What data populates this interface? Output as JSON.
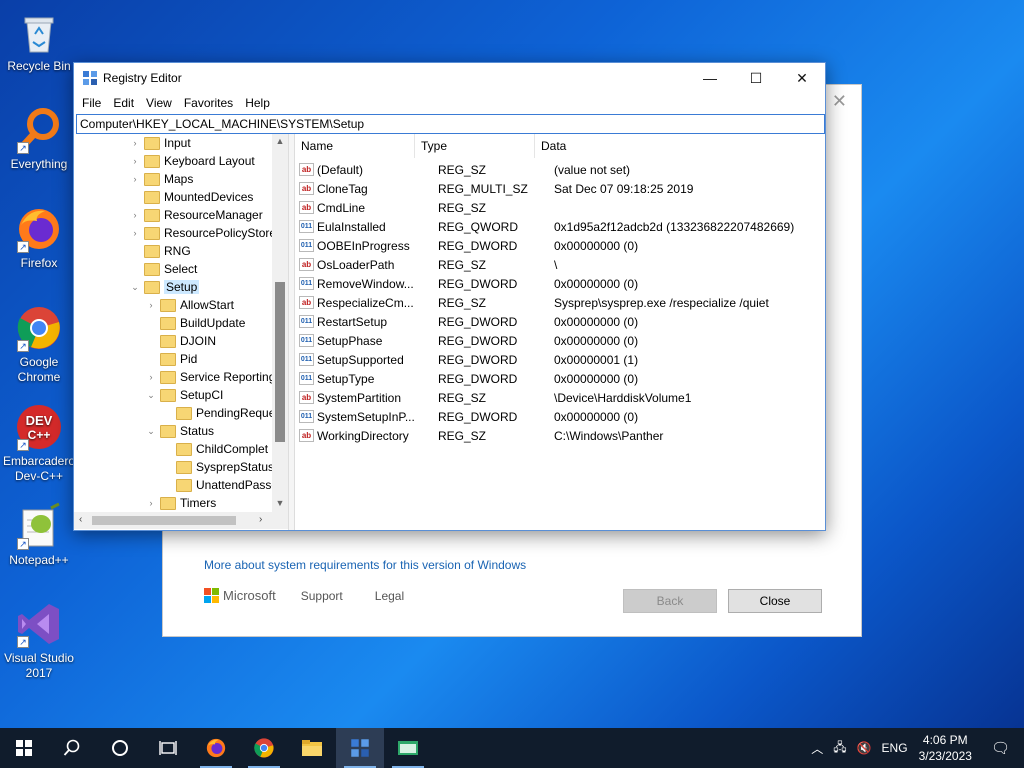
{
  "desktop": {
    "icons": [
      {
        "label": "Recycle Bin"
      },
      {
        "label": "Everything"
      },
      {
        "label": "Firefox"
      },
      {
        "label_line1": "Google",
        "label_line2": "Chrome"
      },
      {
        "label_line1": "Embarcadero",
        "label_line2": "Dev-C++"
      },
      {
        "label": "Notepad++"
      },
      {
        "label_line1": "Visual Studio",
        "label_line2": "2017"
      }
    ]
  },
  "setup_dialog": {
    "close_glyph": "✕",
    "requirements_link": "More about system requirements for this version of Windows",
    "brand": "Microsoft",
    "support_link": "Support",
    "legal_link": "Legal",
    "back_button": "Back",
    "close_button": "Close",
    "colors": {
      "link": "#1a64b3"
    }
  },
  "regedit": {
    "title": "Registry Editor",
    "controls": {
      "minimize": "—",
      "maximize": "☐",
      "close": "✕"
    },
    "menu": [
      "File",
      "Edit",
      "View",
      "Favorites",
      "Help"
    ],
    "address": "Computer\\HKEY_LOCAL_MACHINE\\SYSTEM\\Setup",
    "tree": [
      {
        "label": "Input",
        "expander": "›"
      },
      {
        "label": "Keyboard Layout",
        "expander": "›"
      },
      {
        "label": "Maps",
        "expander": "›"
      },
      {
        "label": "MountedDevices",
        "expander": ""
      },
      {
        "label": "ResourceManager",
        "expander": "›"
      },
      {
        "label": "ResourcePolicyStore",
        "expander": "›"
      },
      {
        "label": "RNG",
        "expander": ""
      },
      {
        "label": "Select",
        "expander": ""
      },
      {
        "label": "Setup",
        "expander": "⌄",
        "selected": true
      },
      {
        "label": "AllowStart",
        "expander": "›"
      },
      {
        "label": "BuildUpdate",
        "expander": ""
      },
      {
        "label": "DJOIN",
        "expander": ""
      },
      {
        "label": "Pid",
        "expander": ""
      },
      {
        "label": "Service Reporting",
        "expander": "›"
      },
      {
        "label": "SetupCI",
        "expander": "⌄"
      },
      {
        "label": "PendingReque",
        "expander": ""
      },
      {
        "label": "Status",
        "expander": "⌄"
      },
      {
        "label": "ChildComplet",
        "expander": ""
      },
      {
        "label": "SysprepStatus",
        "expander": ""
      },
      {
        "label": "UnattendPasse",
        "expander": ""
      },
      {
        "label": "Timers",
        "expander": "›"
      }
    ],
    "columns": {
      "name": "Name",
      "type": "Type",
      "data": "Data"
    },
    "values": [
      {
        "name": "(Default)",
        "type": "REG_SZ",
        "data": "(value not set)",
        "icon": "ab"
      },
      {
        "name": "CloneTag",
        "type": "REG_MULTI_SZ",
        "data": "Sat Dec 07 09:18:25 2019",
        "icon": "ab"
      },
      {
        "name": "CmdLine",
        "type": "REG_SZ",
        "data": "",
        "icon": "ab"
      },
      {
        "name": "EulaInstalled",
        "type": "REG_QWORD",
        "data": "0x1d95a2f12adcb2d (133236822207482669)",
        "icon": "bin"
      },
      {
        "name": "OOBEInProgress",
        "type": "REG_DWORD",
        "data": "0x00000000 (0)",
        "icon": "bin"
      },
      {
        "name": "OsLoaderPath",
        "type": "REG_SZ",
        "data": "\\",
        "icon": "ab"
      },
      {
        "name": "RemoveWindow...",
        "type": "REG_DWORD",
        "data": "0x00000000 (0)",
        "icon": "bin"
      },
      {
        "name": "RespecializeCm...",
        "type": "REG_SZ",
        "data": "Sysprep\\sysprep.exe /respecialize /quiet",
        "icon": "ab"
      },
      {
        "name": "RestartSetup",
        "type": "REG_DWORD",
        "data": "0x00000000 (0)",
        "icon": "bin"
      },
      {
        "name": "SetupPhase",
        "type": "REG_DWORD",
        "data": "0x00000000 (0)",
        "icon": "bin"
      },
      {
        "name": "SetupSupported",
        "type": "REG_DWORD",
        "data": "0x00000001 (1)",
        "icon": "bin"
      },
      {
        "name": "SetupType",
        "type": "REG_DWORD",
        "data": "0x00000000 (0)",
        "icon": "bin"
      },
      {
        "name": "SystemPartition",
        "type": "REG_SZ",
        "data": "\\Device\\HarddiskVolume1",
        "icon": "ab"
      },
      {
        "name": "SystemSetupInP...",
        "type": "REG_DWORD",
        "data": "0x00000000 (0)",
        "icon": "bin"
      },
      {
        "name": "WorkingDirectory",
        "type": "REG_SZ",
        "data": "C:\\Windows\\Panther",
        "icon": "ab"
      }
    ]
  },
  "taskbar": {
    "items": [
      "windows-start",
      "search",
      "cortana",
      "task-view",
      "firefox",
      "chrome",
      "file-explorer",
      "regedit",
      "app"
    ],
    "tray": {
      "language": "ENG",
      "time": "4:06 PM",
      "date": "3/23/2023"
    },
    "colors": {
      "background": "#101c2c",
      "active": "#2d3d55"
    }
  }
}
